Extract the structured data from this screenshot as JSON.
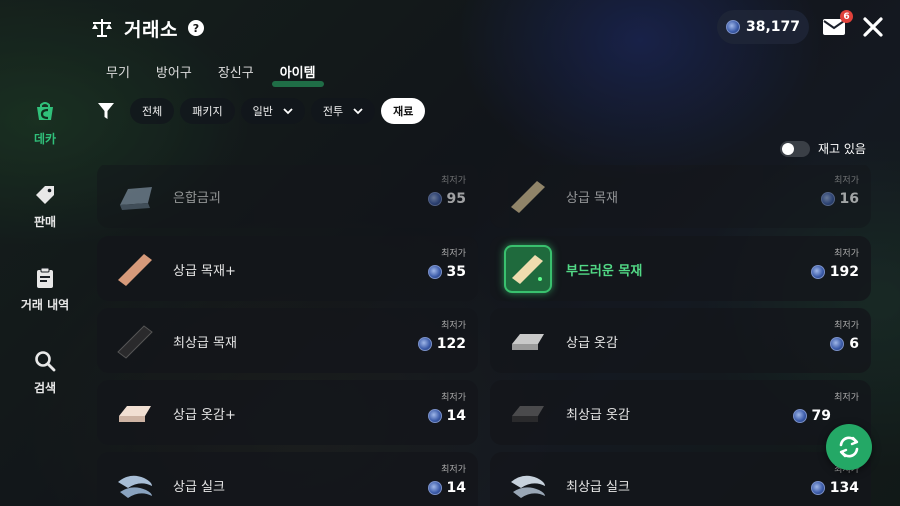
{
  "header": {
    "title": "거래소",
    "help": "?"
  },
  "currency": {
    "amount": "38,177"
  },
  "mail": {
    "badge": "6"
  },
  "tabs": [
    {
      "label": "무기",
      "active": false
    },
    {
      "label": "방어구",
      "active": false
    },
    {
      "label": "장신구",
      "active": false
    },
    {
      "label": "아이템",
      "active": true
    }
  ],
  "filters": {
    "chips": [
      {
        "label": "전체",
        "dropdown": false,
        "active": false
      },
      {
        "label": "패키지",
        "dropdown": false,
        "active": false
      },
      {
        "label": "일반",
        "dropdown": true,
        "active": false
      },
      {
        "label": "전투",
        "dropdown": true,
        "active": false
      },
      {
        "label": "재료",
        "dropdown": false,
        "active": true
      }
    ]
  },
  "stock_toggle": {
    "label": "재고 있음",
    "on": false
  },
  "sidebar": {
    "items": [
      {
        "label": "데카",
        "icon": "deca-bag-icon",
        "active": true
      },
      {
        "label": "판매",
        "icon": "tag-icon",
        "active": false
      },
      {
        "label": "거래 내역",
        "icon": "clipboard-icon",
        "active": false
      },
      {
        "label": "검색",
        "icon": "search-icon",
        "active": false
      }
    ]
  },
  "lowest_label": "최저가",
  "items": [
    {
      "name": "은합금괴",
      "price": "95",
      "icon": "silver-ingot-icon",
      "selected": false
    },
    {
      "name": "상급 목재",
      "price": "16",
      "icon": "wood-plank-icon",
      "selected": false
    },
    {
      "name": "상급 목재+",
      "price": "35",
      "icon": "wood-plank-icon",
      "selected": false
    },
    {
      "name": "부드러운 목재",
      "price": "192",
      "icon": "soft-wood-icon",
      "selected": true
    },
    {
      "name": "최상급 목재",
      "price": "122",
      "icon": "dark-wood-icon",
      "selected": false
    },
    {
      "name": "상급 옷감",
      "price": "6",
      "icon": "cloth-icon",
      "selected": false
    },
    {
      "name": "상급 옷감+",
      "price": "14",
      "icon": "cloth-icon",
      "selected": false
    },
    {
      "name": "최상급 옷감",
      "price": "79",
      "icon": "dark-cloth-icon",
      "selected": false
    },
    {
      "name": "상급 실크",
      "price": "14",
      "icon": "silk-icon",
      "selected": false
    },
    {
      "name": "최상급 실크",
      "price": "134",
      "icon": "silk-icon",
      "selected": false
    }
  ],
  "colors": {
    "accent": "#2aa063",
    "highlight_text": "#52d986",
    "badge": "#e0413a"
  }
}
